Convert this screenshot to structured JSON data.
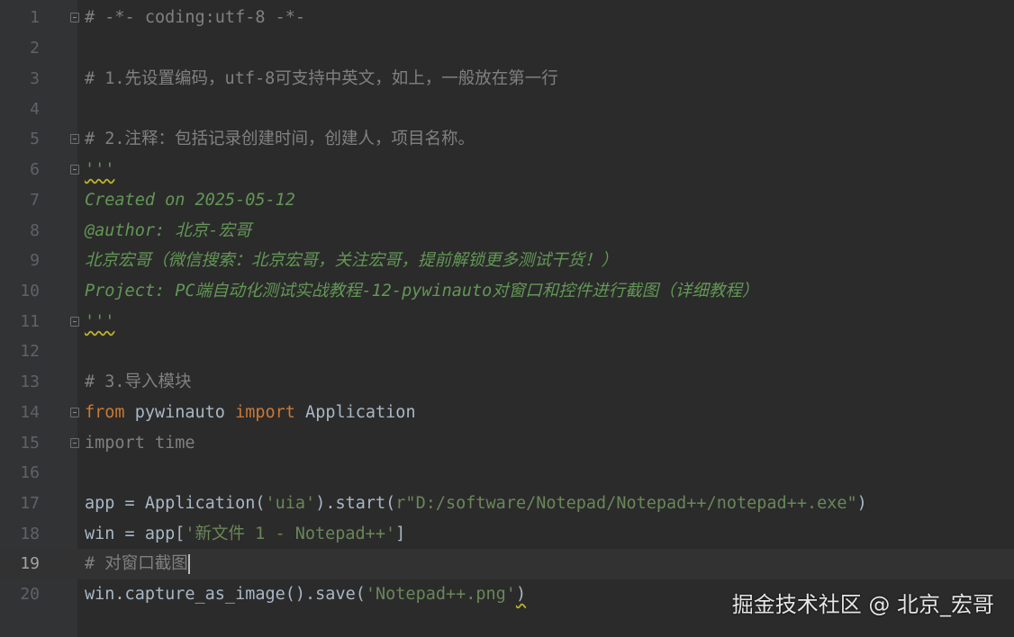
{
  "lines": [
    {
      "num": "1",
      "text": "# -*- coding:utf-8 -*-"
    },
    {
      "num": "2",
      "text": ""
    },
    {
      "num": "3",
      "text": "# 1.先设置编码，utf-8可支持中英文，如上，一般放在第一行"
    },
    {
      "num": "4",
      "text": ""
    },
    {
      "num": "5",
      "text": "# 2.注释：包括记录创建时间，创建人，项目名称。"
    },
    {
      "num": "6",
      "text": "'''"
    },
    {
      "num": "7",
      "text": "Created on 2025-05-12"
    },
    {
      "num": "8",
      "text": "@author: 北京-宏哥"
    },
    {
      "num": "9",
      "text": "北京宏哥（微信搜索：北京宏哥，关注宏哥，提前解锁更多测试干货！）"
    },
    {
      "num": "10",
      "text": "Project: PC端自动化测试实战教程-12-pywinauto对窗口和控件进行截图（详细教程）"
    },
    {
      "num": "11",
      "text": "'''"
    },
    {
      "num": "12",
      "text": ""
    },
    {
      "num": "13",
      "text": "# 3.导入模块"
    },
    {
      "num": "14",
      "parts": [
        "from",
        " pywinauto ",
        "import",
        " Application"
      ]
    },
    {
      "num": "15",
      "text": "import time"
    },
    {
      "num": "16",
      "text": ""
    },
    {
      "num": "17",
      "parts": [
        "app = Application(",
        "'uia'",
        ").start(",
        "r\"D:/software/Notepad/Notepad++/notepad++.exe\"",
        ")"
      ]
    },
    {
      "num": "18",
      "parts": [
        "win = app[",
        "'新文件 1 - Notepad++'",
        "]"
      ]
    },
    {
      "num": "19",
      "text": "# 对窗口截图"
    },
    {
      "num": "20",
      "parts": [
        "win.capture_as_image().save(",
        "'Notepad++.png'",
        ")"
      ]
    }
  ],
  "watermark": "掘金技术社区 @ 北京_宏哥"
}
